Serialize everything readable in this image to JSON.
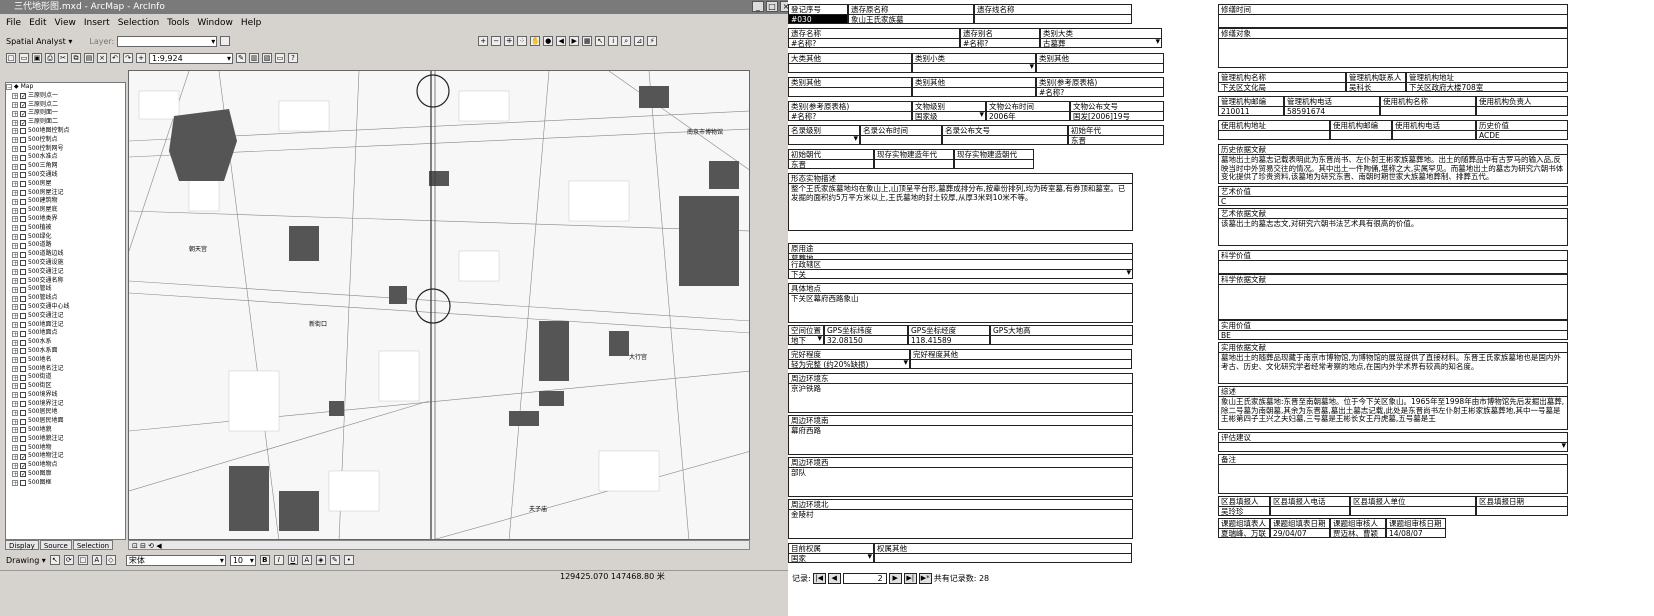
{
  "arcmap": {
    "window_title": "三代地形图.mxd - ArcMap - ArcInfo",
    "menu": [
      "File",
      "Edit",
      "View",
      "Insert",
      "Selection",
      "Tools",
      "Window",
      "Help"
    ],
    "spatial_analyst_label": "Spatial Analyst ▾",
    "layer_label": "Layer:",
    "scale": "1:9,924",
    "toc": {
      "root_label": "Map",
      "layers": [
        "三原则点一",
        "三原则点二",
        "三原则面一",
        "三原则面二",
        "500地图控制点",
        "500控制点",
        "500控制网号",
        "500水准点",
        "500三角网",
        "500交通线",
        "500房屋",
        "500房屋注记",
        "500建筑物",
        "500房屋底",
        "500地类界",
        "500植被",
        "500绿化",
        "500道路",
        "500道路边线",
        "500交通设施",
        "500交通注记",
        "500交通名称",
        "500管线",
        "500管线点",
        "500交通中心线",
        "500交通注记",
        "500地面注记",
        "500地面点",
        "500水系",
        "500水系面",
        "500地名",
        "500地名注记",
        "500街道",
        "500街区",
        "500境界线",
        "500境界注记",
        "500居民地",
        "500居民地面",
        "500地貌",
        "500地貌注记",
        "500地物",
        "500地物注记",
        "500地物点",
        "500图廓",
        "500图框"
      ],
      "checked_indexes": [
        0,
        1,
        2,
        3,
        41,
        42,
        43
      ]
    },
    "toc_tabs": [
      "Display",
      "Source",
      "Selection"
    ],
    "drawing_label": "Drawing ▾",
    "font_name": "宋体",
    "font_size": "10",
    "map_labels": [
      "南京市博物馆",
      "大行宫",
      "新街口",
      "朝天宫",
      "夫子庙"
    ],
    "coords": "129425.070  147468.80 米"
  },
  "form": {
    "fields": {
      "reg_no_label": "登记序号",
      "reg_no_value": "#030",
      "heritage_name_label": "遗存原名称",
      "heritage_name_value": "象山王氏家族墓",
      "heritage_line_label": "遗存线名称",
      "heritage_name2_label": "遗存名称",
      "heritage_name2_value": "#名称?",
      "heritage_alias_label": "遗存别名",
      "heritage_alias_value": "#名称?",
      "category_label": "类别大类",
      "category_value": "古墓葬",
      "major_other_label": "大类其他",
      "sub_small_label": "类别小类",
      "sub_other_label": "类别其他",
      "cat_other_label": "类别其他",
      "cat_other2_label": "类别其他",
      "cat_ref_label": "类别(参考原表格)",
      "cat_ref_value": "#名称?",
      "cat2_ref_label": "类别(参考原表格)",
      "cat2_ref_value": "#名称?",
      "heritage_level_label": "文物级别",
      "heritage_level_value": "国家级",
      "announce_time_label": "文物公布时间",
      "announce_time_value": "2006年",
      "announce_doc_label": "文物公布文号",
      "announce_doc_value": "国发[2006]19号",
      "famous_level_label": "名录级别",
      "famous_time_label": "名录公布时间",
      "famous_doc_label": "名录公布文号",
      "first_era_label": "初始年代",
      "first_era_value": "东晋",
      "begin_era_label": "初始朝代",
      "begin_era_value": "东晋",
      "remain_era_label": "现存实物建造年代",
      "remain_dynasty_label": "现存实物建造朝代",
      "current_desc_label": "形态实物描述",
      "current_desc_value": "整个王氏家族墓地均在象山上,山顶呈平台形,墓葬成排分布,按辈份排列,均为砖室墓,有券顶和墓室。已发掘的面积约5万平方米以上,王氏墓地的封土较厚,从厚3米到10米不等。",
      "orig_use_label": "原用途",
      "orig_use_value": "墓葬地",
      "district_label": "行政辖区",
      "district_value": "下关",
      "location_label": "具体地点",
      "location_value": "下关区幕府西路象山",
      "spatial_label": "空间位置",
      "spatial_value": "地下",
      "gps_lat_label": "GPS坐标纬度",
      "gps_lat_value": "32.08150",
      "gps_lon_label": "GPS坐标经度",
      "gps_lon_value": "118.41589",
      "gps_alt_label": "GPS大地高",
      "damage_label": "完好程度",
      "damage_other_label": "完好程度其他",
      "damage_value": "轻为完整 (约20%缺损)",
      "east_label": "周边环境东",
      "east_value": "京沪铁路",
      "south_label": "周边环境南",
      "south_value": "幕府西路",
      "west_label": "周边环境西",
      "west_value": "部队",
      "north_label": "周边环境北",
      "north_value": "金陵村",
      "current_use_label": "目前权属",
      "current_use_value": "国家",
      "ownership_other_label": "权属其他",
      "repair_time_label": "修缮时间",
      "repair_obj_label": "修缮对象",
      "mgmt_name_label": "管理机构名称",
      "mgmt_name_value": "下关区文化局",
      "mgmt_contact_label": "管理机构联系人",
      "mgmt_contact_value": "吴科长",
      "mgmt_addr_label": "管理机构地址",
      "mgmt_addr_value": "下关区政府大楼708室",
      "mgmt_zip_label": "管理机构邮编",
      "mgmt_zip_value": "210011",
      "mgmt_phone_label": "管理机构电话",
      "mgmt_phone_value": "58591674",
      "user_name_label": "使用机构名称",
      "user_head_label": "使用机构负责人",
      "user_addr_label": "使用机构地址",
      "user_zip_label": "使用机构邮编",
      "user_phone_label": "使用机构电话",
      "hist_value_label": "历史价值",
      "hist_value_value": "ACDE",
      "hist_doc_label": "历史依据文献",
      "hist_doc_value": "墓地出土的墓志记载表明此为东晋尚书、左仆射王彬家族墓葬地。出土的随葬品中有古罗马的输入品,反映当时中外贸易交往的情况。其中出土一件陶俑,堪称之大,实属罕见。而墓地出土的墓志为研究六朝书体变化提供了珍贵资料,该墓地为研究东晋、南朝时期世家大族墓地葬制、排葬五代。",
      "art_value_label": "艺术价值",
      "art_value_value": "C",
      "art_doc_label": "艺术依据文献",
      "art_doc_value": "该墓出土的墓志志文,对研究六朝书法艺术具有很高的价值。",
      "sci_value_label": "科学价值",
      "sci_doc_label": "科学依据文献",
      "prac_value_label": "实用价值",
      "prac_value_value": "BE",
      "prac_doc_label": "实用依据文献",
      "prac_doc_value": "墓地出土的随葬品现藏于南京市博物馆,为博物馆的展览提供了直接材料。东晋王氏家族墓地也是国内外考古、历史、文化研究学者经常考察的地点,在国内外学术界有较高的知名度。",
      "summary_label": "综述",
      "summary_value": "象山王氏家族墓地:东晋至南朝墓地。位于今下关区象山。1965年至1998年由市博物馆先后发掘出墓葬,除二号墓为南朝墓,其余为东晋墓,墓出土墓志记载,此处是东晋尚书左仆射王彬家族墓葬地,其中一号墓是王彬第四子王兴之夫妇墓,三号墓是王彬长女王丹虎墓,五号墓是王",
      "suggest_label": "评估建议",
      "remarks_label": "备注",
      "survey_person_label": "区县填报人",
      "survey_person_value": "吴玲珍",
      "survey_phone_label": "区县填报人电话",
      "survey_unit_label": "区县填报人单位",
      "survey_date_label": "区县填报日期",
      "team_fill_label": "课题组填表人",
      "team_fill_value": "夏瑞峰、万联",
      "team_fill_date_label": "课题组填表日期",
      "team_fill_date_value": "29/04/07",
      "team_check_label": "课题组审核人",
      "team_check_value": "贾迈林、曹颖",
      "team_check_date_label": "课题组审核日期",
      "team_check_date_value": "14/08/07"
    },
    "nav": {
      "record_label": "记录:",
      "current": "2",
      "total_label": "共有记录数: 28"
    }
  }
}
